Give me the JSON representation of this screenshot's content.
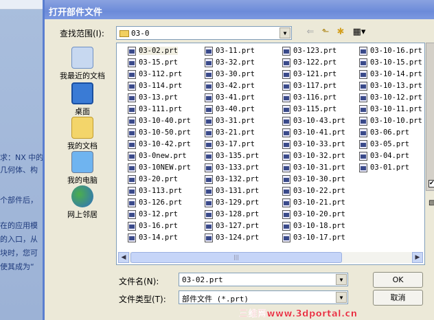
{
  "background": {
    "lines": [
      "求：NX 中的",
      "几何体、构",
      "个部件后，",
      "在的应用模",
      "的入口，从",
      "块时，您可",
      "使其成为“"
    ]
  },
  "dialog": {
    "title": "打开部件文件",
    "look_in_label": "查找范围(I):",
    "look_in_value": "03-0",
    "places": [
      "我最近的文档",
      "桌面",
      "我的文档",
      "我的电脑",
      "网上邻居"
    ],
    "files": [
      [
        "03-02.prt",
        "03-15.prt",
        "03-112.prt",
        "03-114.prt",
        "03-13.prt",
        "03-111.prt",
        "03-10-40.prt",
        "03-10-50.prt",
        "03-10-42.prt",
        "03-0new.prt",
        "03-10NEW.prt",
        "03-20.prt",
        "03-113.prt",
        "03-126.prt",
        "03-12.prt",
        "03-16.prt",
        "03-14.prt"
      ],
      [
        "03-11.prt",
        "03-32.prt",
        "03-30.prt",
        "03-42.prt",
        "03-41.prt",
        "03-40.prt",
        "03-31.prt",
        "03-21.prt",
        "03-17.prt",
        "03-135.prt",
        "03-133.prt",
        "03-132.prt",
        "03-131.prt",
        "03-129.prt",
        "03-128.prt",
        "03-127.prt",
        "03-124.prt"
      ],
      [
        "03-123.prt",
        "03-122.prt",
        "03-121.prt",
        "03-117.prt",
        "03-116.prt",
        "03-115.prt",
        "03-10-43.prt",
        "03-10-41.prt",
        "03-10-33.prt",
        "03-10-32.prt",
        "03-10-31.prt",
        "03-10-30.prt",
        "03-10-22.prt",
        "03-10-21.prt",
        "03-10-20.prt",
        "03-10-18.prt",
        "03-10-17.prt"
      ],
      [
        "03-10-16.prt",
        "03-10-15.prt",
        "03-10-14.prt",
        "03-10-13.prt",
        "03-10-12.prt",
        "03-10-11.prt",
        "03-10-10.prt",
        "03-06.prt",
        "03-05.prt",
        "03-04.prt",
        "03-01.prt"
      ]
    ],
    "filename_label": "文件名(N):",
    "filename_value": "03-02.prt",
    "filetype_label": "文件类型(T):",
    "filetype_value": "部件文件 (*.prt)",
    "ok_label": "OK",
    "cancel_label": "取消"
  },
  "watermark": "三维网www.3dportal.cn"
}
